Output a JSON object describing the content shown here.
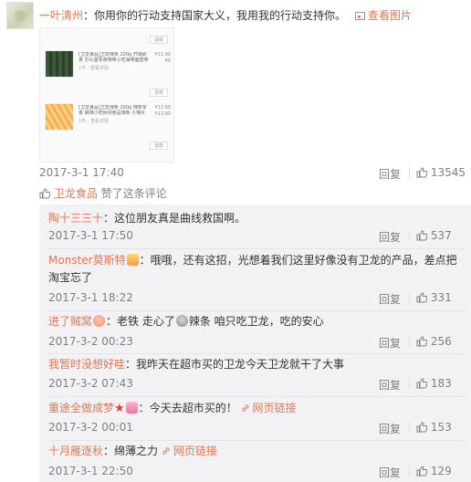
{
  "main_comment": {
    "author": "一叶清州",
    "separator": "：",
    "text": "你用你的行动支持国家大义，我用我的行动支持你。",
    "view_pic_label": "查看图片",
    "screenshot": {
      "products": [
        {
          "title": "[卫龙食品]卫龙辣条 200g 开袋即食 办公室零食辣味小吃海带面筋味",
          "sub": "1件 · 查看详情",
          "price": "¥11.90",
          "orig": "¥0"
        },
        {
          "title": "[卫龙食品]卫龙辣条 200g 辣条零食 麻辣小吃休闲食品辣条 小辣片",
          "sub": "1件 · 查看详情",
          "price": "¥12.90",
          "orig": "¥13.90"
        }
      ],
      "button_label": "退款"
    },
    "time": "2017-3-1 17:40",
    "reply_label": "回复",
    "likes": "13545"
  },
  "liked_by": {
    "brand": "卫龙食品",
    "text": "赞了这条评论"
  },
  "colors": {
    "link": "#eb7350",
    "muted": "#808080",
    "reply_bg": "#f2f2f5"
  },
  "replies": [
    {
      "author": "陶十三三十",
      "sep": "：",
      "text": "这位朋友真是曲线救国啊。",
      "time": "2017-3-1 17:50",
      "reply_label": "回复",
      "likes": "537"
    },
    {
      "author": "Monster莫斯特",
      "sep": "：",
      "text": "哦哦，还有这招，光想着我们这里好像没有卫龙的产品，差点把淘宝忘了",
      "time": "2017-3-1 18:22",
      "reply_label": "回复",
      "likes": "331"
    },
    {
      "author": "进了贼窝",
      "sep": "：",
      "text_a": "老铁 走心了",
      "text_b": "辣条 咱只吃卫龙，吃的安心",
      "time": "2017-3-2 00:23",
      "reply_label": "回复",
      "likes": "256"
    },
    {
      "author": "我暂时没想好哇",
      "sep": "：",
      "text": "我昨天在超市买的卫龙今天卫龙就干了大事",
      "time": "2017-3-2 07:43",
      "reply_label": "回复",
      "likes": "183"
    },
    {
      "author": "重途全做成梦",
      "sep": "：",
      "text": "今天去超市买的！",
      "link_label": "网页链接",
      "time": "2017-3-2 00:01",
      "reply_label": "回复",
      "likes": "153"
    },
    {
      "author": "十月雁逐秋",
      "sep": "：",
      "text": "绵薄之力",
      "link_label": "网页链接",
      "time": "2017-3-1 22:50",
      "reply_label": "回复",
      "likes": "129"
    }
  ]
}
